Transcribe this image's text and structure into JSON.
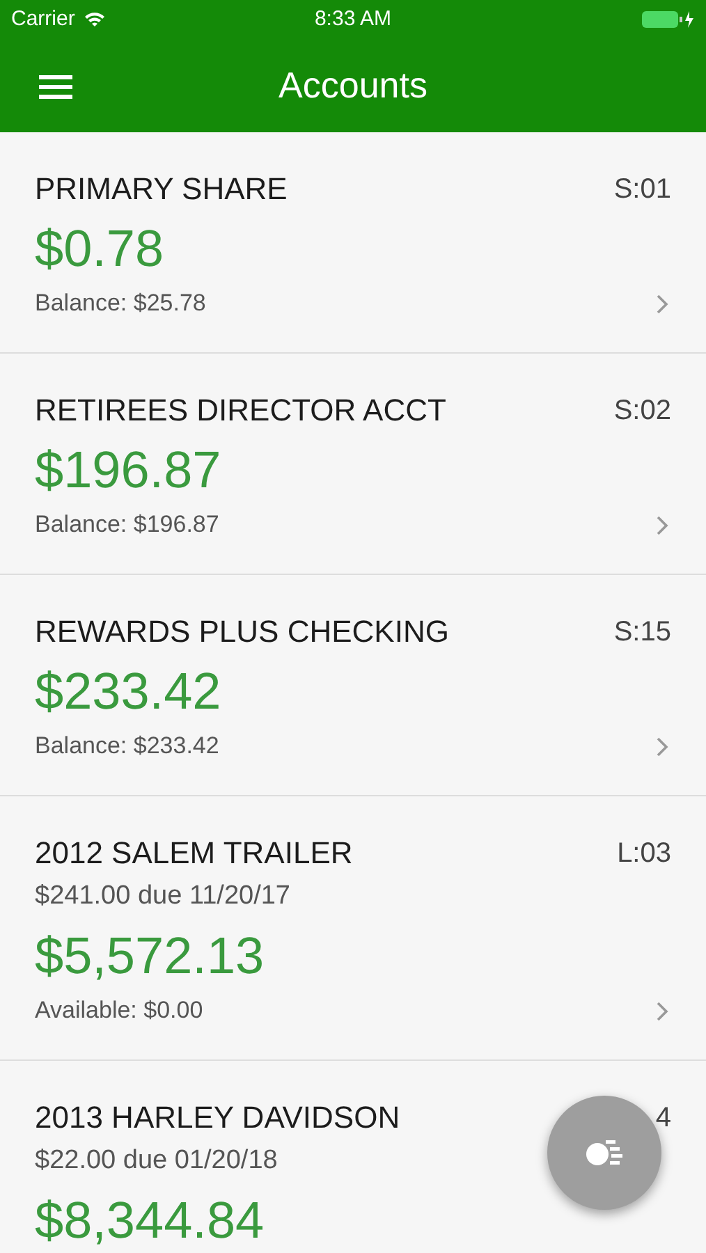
{
  "status_bar": {
    "carrier": "Carrier",
    "time": "8:33 AM"
  },
  "header": {
    "title": "Accounts"
  },
  "accounts": [
    {
      "name": "PRIMARY SHARE",
      "code": "S:01",
      "amount": "$0.78",
      "footer": "Balance: $25.78"
    },
    {
      "name": "RETIREES DIRECTOR ACCT",
      "code": "S:02",
      "amount": "$196.87",
      "footer": "Balance: $196.87"
    },
    {
      "name": "REWARDS PLUS CHECKING",
      "code": "S:15",
      "amount": "$233.42",
      "footer": "Balance: $233.42"
    },
    {
      "name": "2012 SALEM TRAILER",
      "code": "L:03",
      "due": "$241.00 due 11/20/17",
      "amount": "$5,572.13",
      "footer": "Available: $0.00"
    },
    {
      "name": "2013 HARLEY DAVIDSON",
      "code": "4",
      "due": "$22.00 due 01/20/18",
      "amount": "$8,344.84"
    }
  ]
}
